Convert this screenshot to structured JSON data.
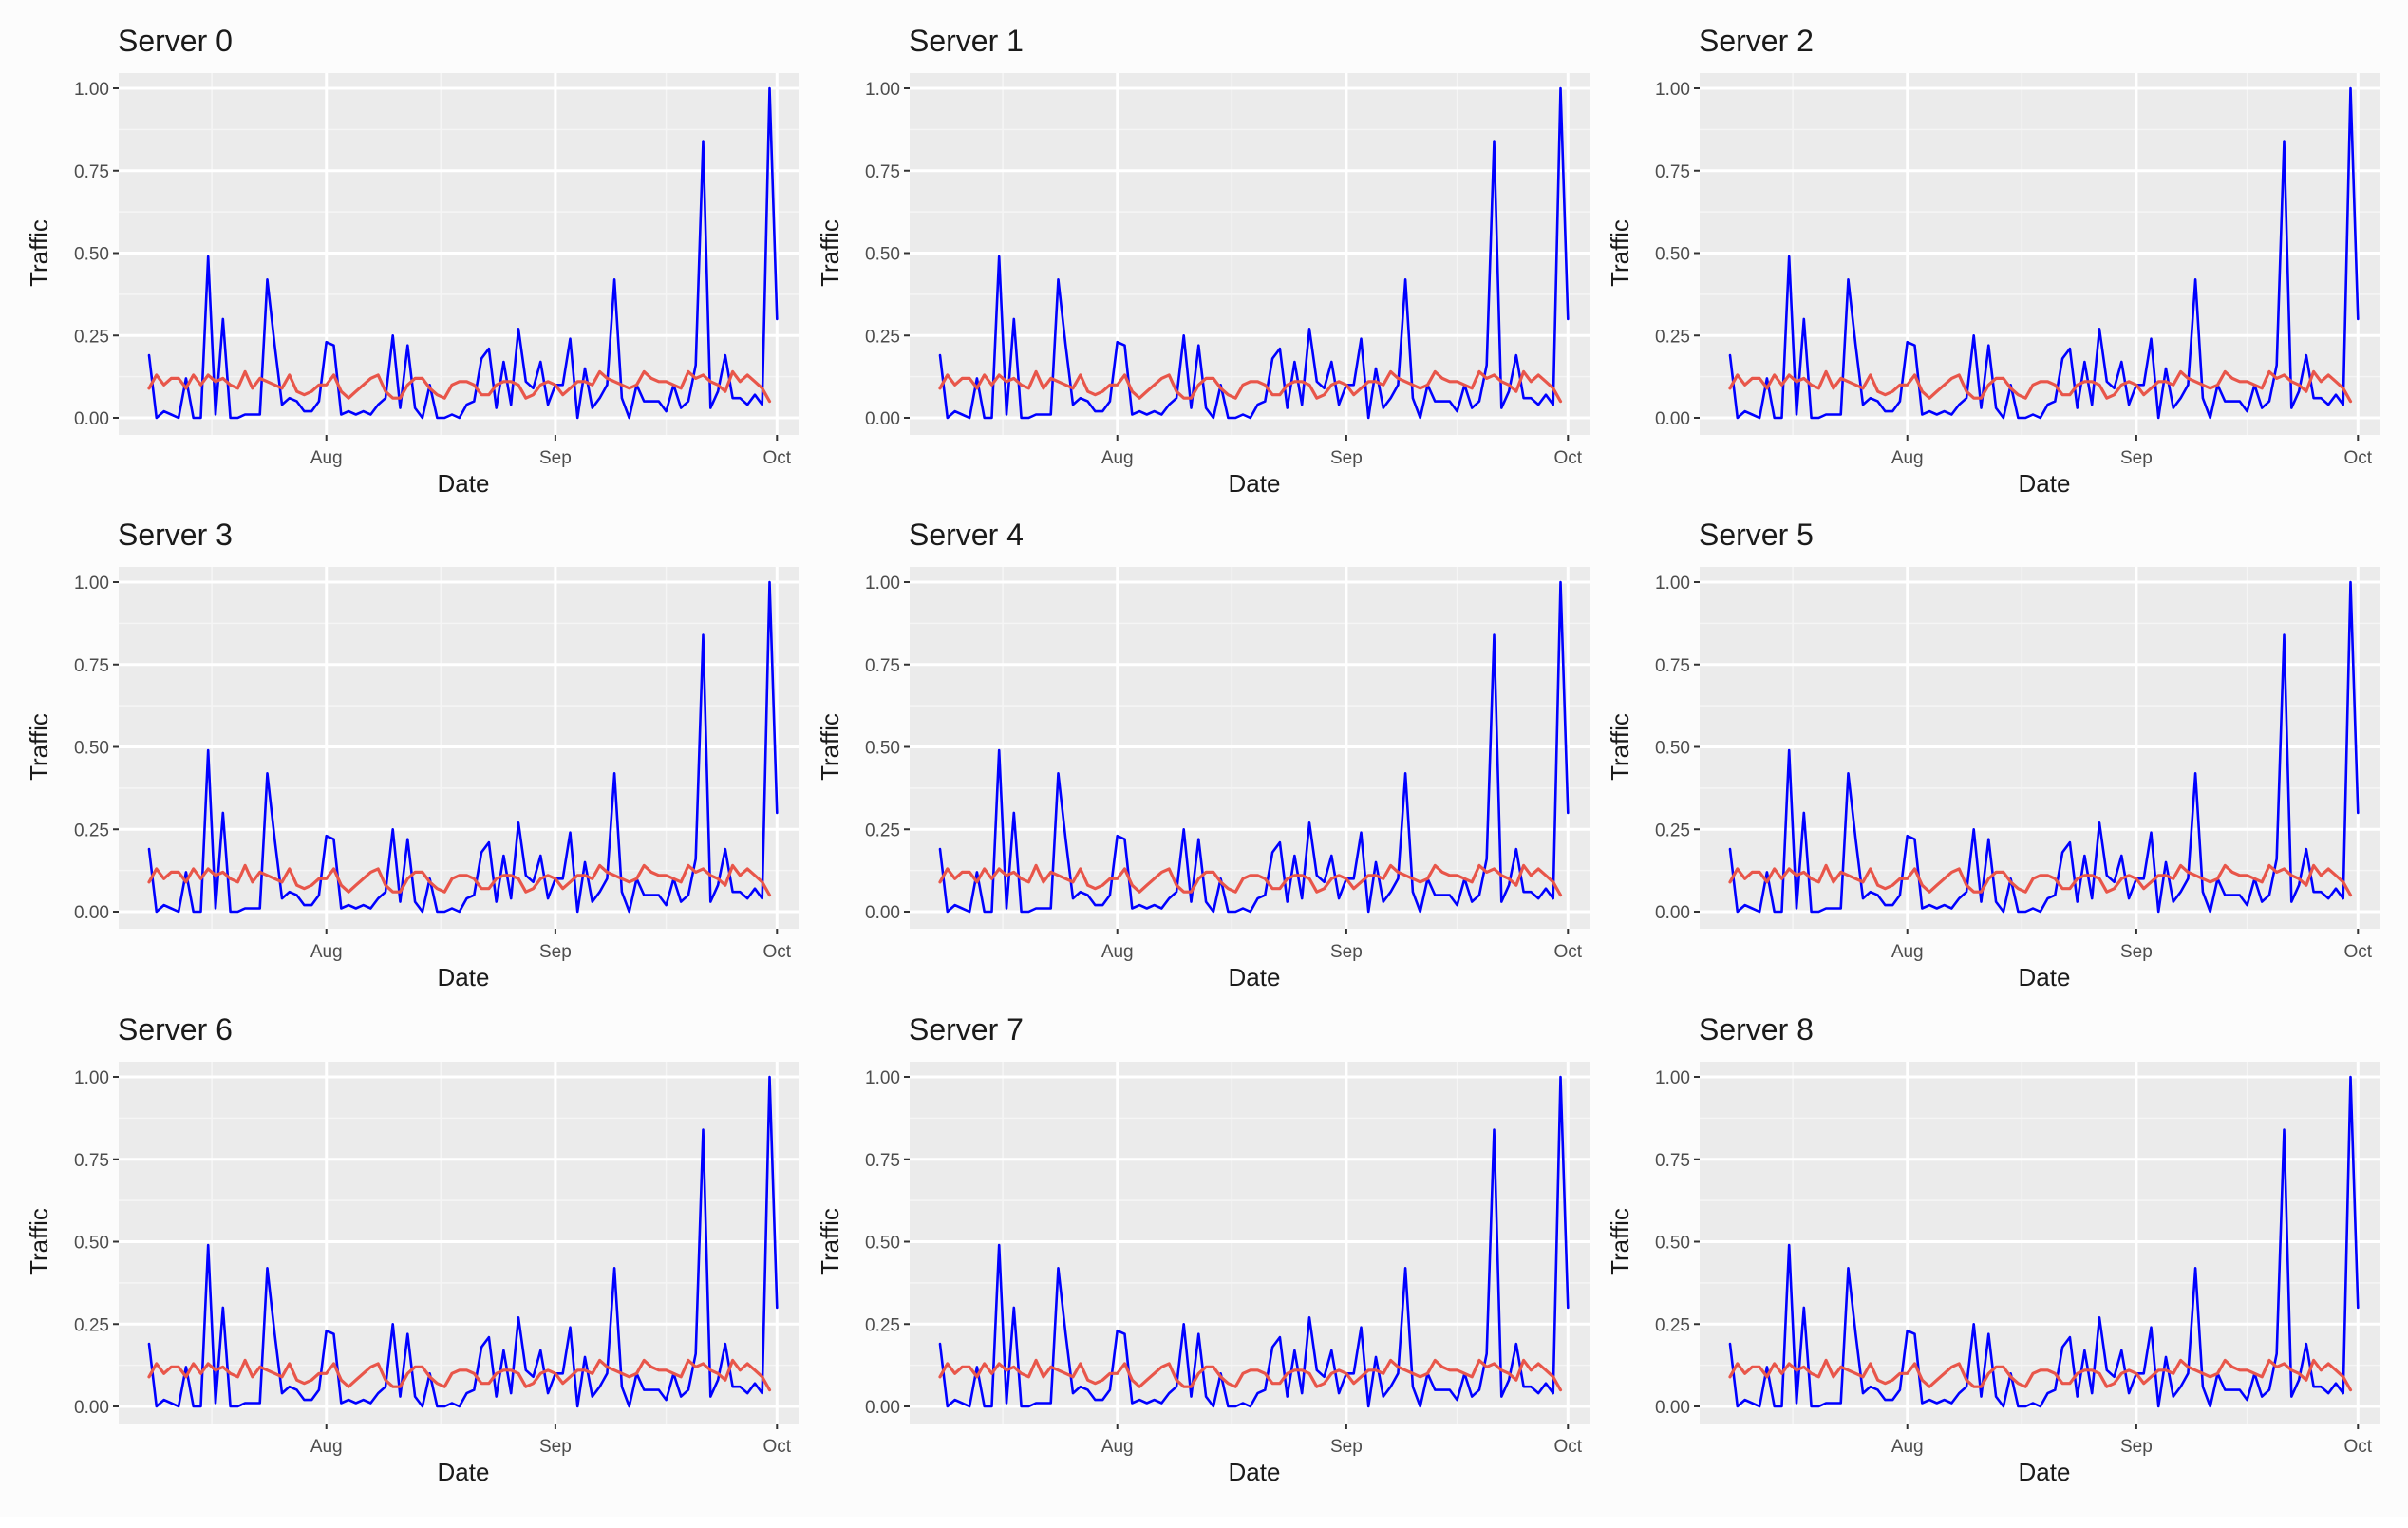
{
  "figure": {
    "layout": "3x3 grid of small multiples",
    "panel_titles": [
      "Server 0",
      "Server 1",
      "Server 2",
      "Server 3",
      "Server 4",
      "Server 5",
      "Server 6",
      "Server 7",
      "Server 8"
    ]
  },
  "colors": {
    "panel_background": "#ebebeb",
    "grid_major": "#ffffff",
    "grid_minor": "#f5f5f5",
    "series_actual": "#0000ff",
    "series_smooth": "#e8564a",
    "tick_label": "#4d4d4d",
    "title": "#1a1a1a"
  },
  "chart_data": {
    "type": "line",
    "title_per_panel": [
      "Server 0",
      "Server 1",
      "Server 2",
      "Server 3",
      "Server 4",
      "Server 5",
      "Server 6",
      "Server 7",
      "Server 8"
    ],
    "xlabel": "Date",
    "ylabel": "Traffic",
    "x_tick_labels": [
      "Aug",
      "Sep",
      "Oct"
    ],
    "x_tick_days": [
      24,
      55,
      85
    ],
    "x_range_days": [
      -4,
      87
    ],
    "x_start_date": "Jul 8",
    "y_ticks": [
      0.0,
      0.25,
      0.5,
      0.75,
      1.0
    ],
    "y_tick_labels": [
      "0.00",
      "0.25",
      "0.50",
      "0.75",
      "1.00"
    ],
    "ylim": [
      -0.05,
      1.04
    ],
    "grid": true,
    "legend": "none",
    "note": "All nine panels display the same series",
    "series": [
      {
        "name": "traffic",
        "color": "#0000ff",
        "values": [
          0.19,
          0.0,
          0.02,
          0.01,
          0.0,
          0.12,
          0.0,
          0.0,
          0.49,
          0.01,
          0.3,
          0.0,
          0.0,
          0.01,
          0.01,
          0.01,
          0.42,
          0.22,
          0.04,
          0.06,
          0.05,
          0.02,
          0.02,
          0.05,
          0.23,
          0.22,
          0.01,
          0.02,
          0.01,
          0.02,
          0.01,
          0.04,
          0.06,
          0.25,
          0.03,
          0.22,
          0.03,
          0.0,
          0.1,
          0.0,
          0.0,
          0.01,
          0.0,
          0.04,
          0.05,
          0.18,
          0.21,
          0.03,
          0.17,
          0.04,
          0.27,
          0.11,
          0.09,
          0.17,
          0.04,
          0.1,
          0.1,
          0.24,
          0.0,
          0.15,
          0.03,
          0.06,
          0.1,
          0.42,
          0.06,
          0.0,
          0.1,
          0.05,
          0.05,
          0.05,
          0.02,
          0.1,
          0.03,
          0.05,
          0.16,
          0.84,
          0.03,
          0.08,
          0.19,
          0.06,
          0.06,
          0.04,
          0.07,
          0.04,
          1.0,
          0.3
        ]
      },
      {
        "name": "smoothed",
        "color": "#e8564a",
        "values": [
          0.09,
          0.13,
          0.1,
          0.12,
          0.12,
          0.09,
          0.13,
          0.1,
          0.13,
          0.11,
          0.12,
          0.1,
          0.09,
          0.14,
          0.09,
          0.12,
          0.11,
          0.1,
          0.09,
          0.13,
          0.08,
          0.07,
          0.08,
          0.1,
          0.1,
          0.13,
          0.08,
          0.06,
          0.08,
          0.1,
          0.12,
          0.13,
          0.08,
          0.06,
          0.06,
          0.1,
          0.12,
          0.12,
          0.09,
          0.07,
          0.06,
          0.1,
          0.11,
          0.11,
          0.1,
          0.07,
          0.07,
          0.1,
          0.11,
          0.11,
          0.1,
          0.06,
          0.07,
          0.1,
          0.11,
          0.1,
          0.07,
          0.09,
          0.11,
          0.11,
          0.1,
          0.14,
          0.12,
          0.11,
          0.1,
          0.09,
          0.1,
          0.14,
          0.12,
          0.11,
          0.11,
          0.1,
          0.09,
          0.14,
          0.12,
          0.13,
          0.11,
          0.1,
          0.08,
          0.14,
          0.11,
          0.13,
          0.11,
          0.09,
          0.05
        ]
      }
    ]
  }
}
